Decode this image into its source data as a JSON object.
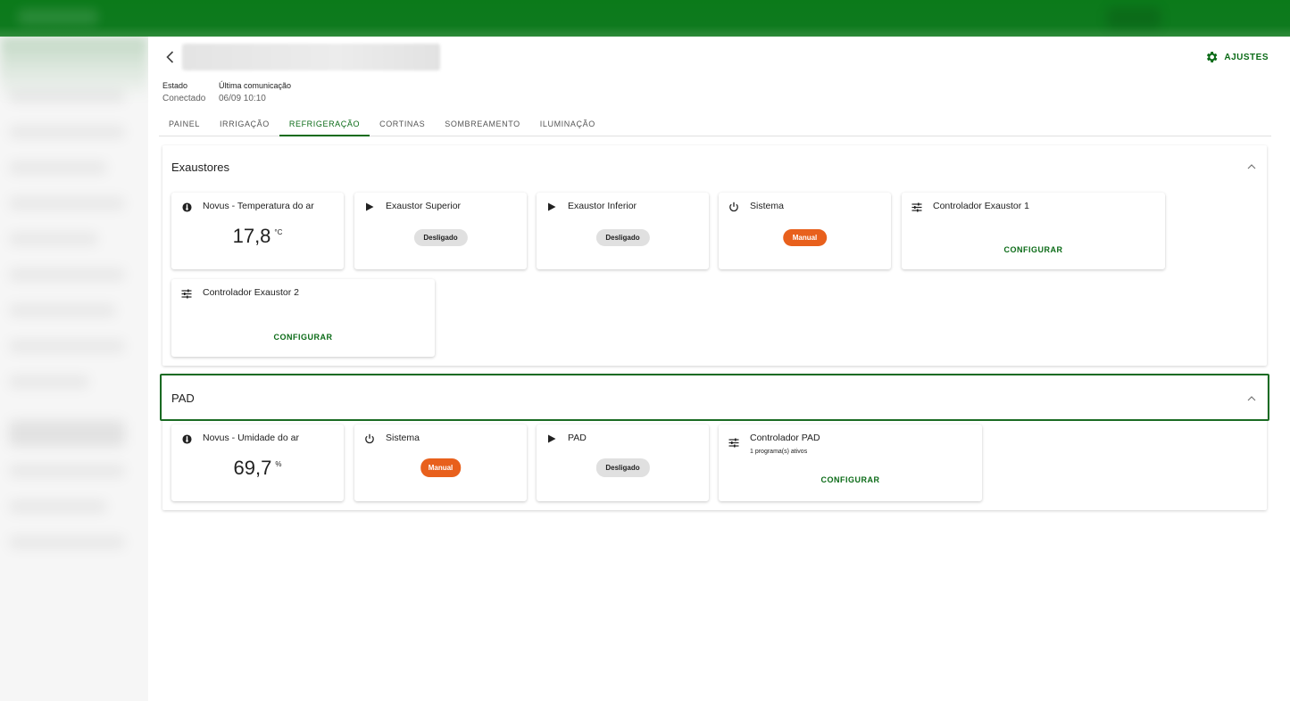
{
  "header": {
    "title": "",
    "settings_label": "AJUSTES"
  },
  "status": {
    "state_label": "Estado",
    "state_value": "Conectado",
    "last_comm_label": "Última comunicação",
    "last_comm_value": "06/09 10:10"
  },
  "tabs": [
    {
      "label": "PAINEL",
      "active": false
    },
    {
      "label": "IRRIGAÇÃO",
      "active": false
    },
    {
      "label": "REFRIGERAÇÃO",
      "active": true
    },
    {
      "label": "CORTINAS",
      "active": false
    },
    {
      "label": "SOMBREAMENTO",
      "active": false
    },
    {
      "label": "ILUMINAÇÃO",
      "active": false
    }
  ],
  "sections": {
    "exaustores": {
      "title": "Exaustores",
      "cards": {
        "temp": {
          "title": "Novus - Temperatura do ar",
          "value": "17,8",
          "unit": "°C",
          "icon": "thermometer-icon"
        },
        "exaustor_superior": {
          "title": "Exaustor Superior",
          "status": "Desligado",
          "icon": "play-icon"
        },
        "exaustor_inferior": {
          "title": "Exaustor Inferior",
          "status": "Desligado",
          "icon": "play-icon"
        },
        "sistema": {
          "title": "Sistema",
          "status": "Manual",
          "icon": "power-icon"
        },
        "controlador1": {
          "title": "Controlador Exaustor 1",
          "action": "CONFIGURAR",
          "icon": "sliders-icon"
        },
        "controlador2": {
          "title": "Controlador Exaustor 2",
          "action": "CONFIGURAR",
          "icon": "sliders-icon"
        }
      }
    },
    "pad": {
      "title": "PAD",
      "cards": {
        "umidade": {
          "title": "Novus - Umidade do ar",
          "value": "69,7",
          "unit": "%",
          "icon": "thermometer-icon"
        },
        "sistema": {
          "title": "Sistema",
          "status": "Manual",
          "icon": "power-icon"
        },
        "pad": {
          "title": "PAD",
          "status": "Desligado",
          "icon": "play-icon"
        },
        "controlador": {
          "title": "Controlador PAD",
          "subtitle": "1 programa(s) ativos",
          "action": "CONFIGURAR",
          "icon": "sliders-icon"
        }
      }
    }
  },
  "colors": {
    "primary": "#0b6b17",
    "manual_chip": "#e8601c",
    "off_chip": "#e0e0e0"
  }
}
